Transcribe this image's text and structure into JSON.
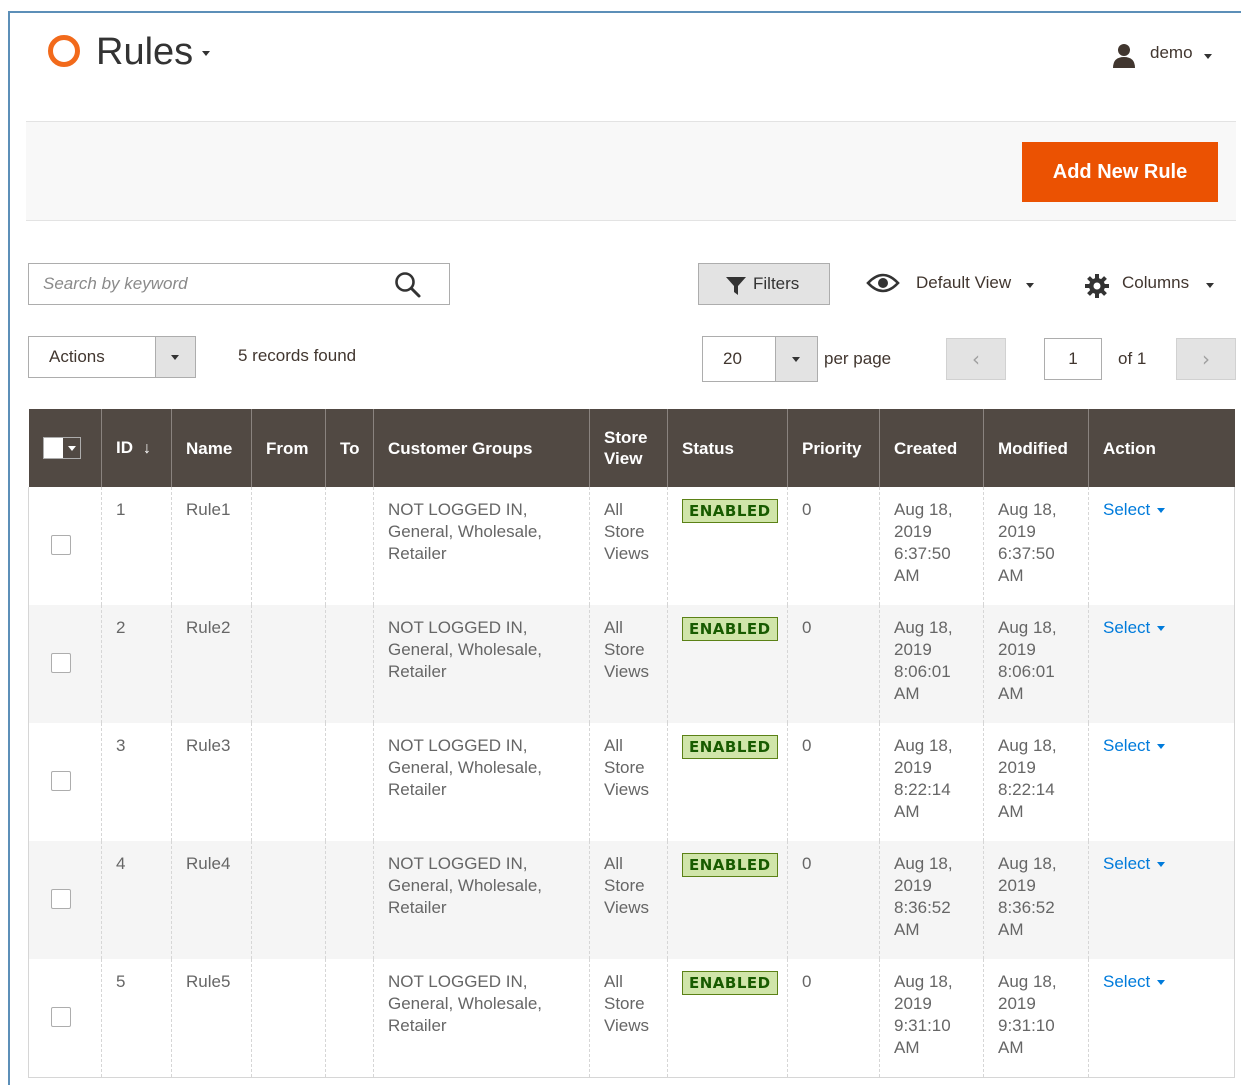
{
  "header": {
    "title": "Rules",
    "user_name": "demo"
  },
  "toolbar": {
    "add_button_label": "Add New Rule",
    "search_placeholder": "Search by keyword",
    "filters_label": "Filters",
    "view_label": "Default View",
    "columns_label": "Columns",
    "actions_label": "Actions",
    "records_found": "5 records found",
    "per_page_value": "20",
    "per_page_label": "per page",
    "page_current": "1",
    "page_total": "of 1",
    "prev_label": "‹",
    "next_label": "›"
  },
  "table": {
    "columns": [
      "ID",
      "Name",
      "From",
      "To",
      "Customer Groups",
      "Store View",
      "Status",
      "Priority",
      "Created",
      "Modified",
      "Action"
    ],
    "sort_indicator": "↓",
    "rows": [
      {
        "id": "1",
        "name": "Rule1",
        "from": "",
        "to": "",
        "groups": "NOT LOGGED IN, General, Wholesale, Retailer",
        "store_view": "All Store Views",
        "status": "ENABLED",
        "priority": "0",
        "created": "Aug 18, 2019 6:37:50 AM",
        "modified": "Aug 18, 2019 6:37:50 AM",
        "action": "Select"
      },
      {
        "id": "2",
        "name": "Rule2",
        "from": "",
        "to": "",
        "groups": "NOT LOGGED IN, General, Wholesale, Retailer",
        "store_view": "All Store Views",
        "status": "ENABLED",
        "priority": "0",
        "created": "Aug 18, 2019 8:06:01 AM",
        "modified": "Aug 18, 2019 8:06:01 AM",
        "action": "Select"
      },
      {
        "id": "3",
        "name": "Rule3",
        "from": "",
        "to": "",
        "groups": "NOT LOGGED IN, General, Wholesale, Retailer",
        "store_view": "All Store Views",
        "status": "ENABLED",
        "priority": "0",
        "created": "Aug 18, 2019 8:22:14 AM",
        "modified": "Aug 18, 2019 8:22:14 AM",
        "action": "Select"
      },
      {
        "id": "4",
        "name": "Rule4",
        "from": "",
        "to": "",
        "groups": "NOT LOGGED IN, General, Wholesale, Retailer",
        "store_view": "All Store Views",
        "status": "ENABLED",
        "priority": "0",
        "created": "Aug 18, 2019 8:36:52 AM",
        "modified": "Aug 18, 2019 8:36:52 AM",
        "action": "Select"
      },
      {
        "id": "5",
        "name": "Rule5",
        "from": "",
        "to": "",
        "groups": "NOT LOGGED IN, General, Wholesale, Retailer",
        "store_view": "All Store Views",
        "status": "ENABLED",
        "priority": "0",
        "created": "Aug 18, 2019 9:31:10 AM",
        "modified": "Aug 18, 2019 9:31:10 AM",
        "action": "Select"
      }
    ]
  },
  "colors": {
    "accent": "#eb5202",
    "header_bg": "#514943",
    "link": "#007bdb",
    "status_bg": "#d0e5a9"
  },
  "icons": [
    "logo-icon",
    "user-icon",
    "search-icon",
    "filter-icon",
    "eye-icon",
    "gear-icon"
  ]
}
